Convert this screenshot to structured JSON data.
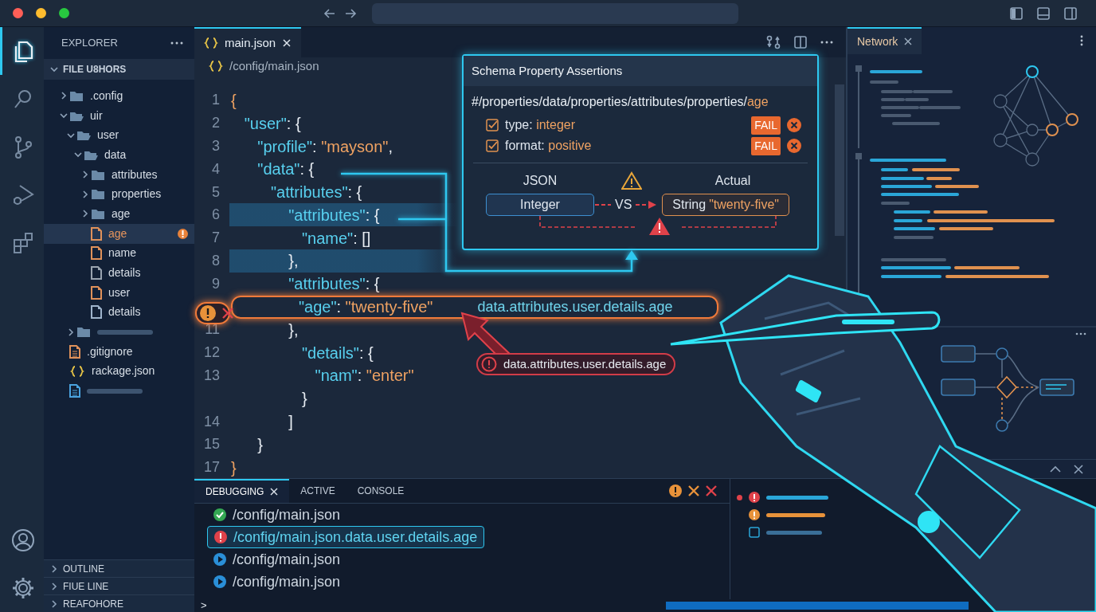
{
  "title_bar": {
    "traffic_lights": [
      {
        "color": "#ff5f57"
      },
      {
        "color": "#febc2e"
      },
      {
        "color": "#28c840"
      }
    ]
  },
  "activity_bar": {
    "items": [
      {
        "kind": "explorer",
        "selected": true
      },
      {
        "kind": "search",
        "selected": false
      },
      {
        "kind": "source-control",
        "selected": false
      },
      {
        "kind": "run-debug",
        "selected": false
      },
      {
        "kind": "extensions",
        "selected": false
      }
    ],
    "bottom_items": [
      {
        "kind": "account"
      },
      {
        "kind": "settings"
      }
    ]
  },
  "sidebar": {
    "title": "EXPLORER",
    "section": "FILE U8HORS",
    "section_expanded": true,
    "tree": [
      {
        "kind": "folder",
        "label": ".config",
        "expanded": false
      },
      {
        "kind": "folder",
        "label": "uir",
        "expanded": true,
        "children": [
          {
            "kind": "folder",
            "label": "user",
            "expanded": true,
            "children": [
              {
                "kind": "folder",
                "label": "data",
                "expanded": true,
                "children": [
                  {
                    "kind": "folder",
                    "label": "attributes",
                    "expanded": false
                  },
                  {
                    "kind": "folder",
                    "label": "properties",
                    "expanded": false
                  },
                  {
                    "kind": "folder",
                    "label": "age",
                    "expanded": false
                  },
                  {
                    "kind": "file",
                    "label": "age",
                    "color": "#e0915a",
                    "selected": true,
                    "warning": true
                  },
                  {
                    "kind": "file",
                    "label": "name",
                    "color": "#e0915a",
                    "selected": false,
                    "warning": false
                  },
                  {
                    "kind": "file",
                    "label": "details",
                    "color": "#9aa4b0",
                    "selected": false,
                    "warning": false
                  },
                  {
                    "kind": "file",
                    "label": "user",
                    "color": "#e0915a",
                    "selected": false,
                    "warning": false
                  },
                  {
                    "kind": "file",
                    "label": "details",
                    "color": "#9fb4cc",
                    "selected": false,
                    "warning": false
                  }
                ]
              }
            ]
          },
          {
            "kind": "folder",
            "expanded": false
          }
        ]
      },
      {
        "kind": "file",
        "label": ".gitignore",
        "color": "#e0915a",
        "selected": false,
        "warning": false
      },
      {
        "kind": "json",
        "label": "rackage.json",
        "color": "#e8c547",
        "selected": false,
        "warning": false
      },
      {
        "kind": "file",
        "color": "#4aa3df",
        "selected": false,
        "warning": false
      }
    ],
    "sections": [
      {
        "label": "OUTLINE",
        "expanded": false
      },
      {
        "label": "FIUE LINE",
        "expanded": false
      },
      {
        "label": "REAFOHORE",
        "expanded": false
      }
    ]
  },
  "editor": {
    "tabs": [
      {
        "label": "main.json",
        "selected": true
      }
    ],
    "breadcrumb": "/config/main.json",
    "lines": [
      {
        "number": "1",
        "highlighted": false,
        "error": false,
        "tokens": [
          {
            "kind": "brace",
            "text": "{"
          }
        ]
      },
      {
        "number": "2",
        "highlighted": false,
        "error": false,
        "tokens": [
          {
            "kind": "key",
            "text": "   \"user\""
          },
          {
            "kind": "punct",
            "text": ": {"
          }
        ]
      },
      {
        "number": "3",
        "highlighted": false,
        "error": false,
        "tokens": [
          {
            "kind": "key",
            "text": "      \"profile\""
          },
          {
            "kind": "punct",
            "text": ": "
          },
          {
            "kind": "string",
            "text": "\"mayson\""
          },
          {
            "kind": "punct",
            "text": ","
          }
        ]
      },
      {
        "number": "4",
        "highlighted": false,
        "error": false,
        "tokens": [
          {
            "kind": "key",
            "text": "      \"data\""
          },
          {
            "kind": "punct",
            "text": ": {"
          }
        ]
      },
      {
        "number": "5",
        "highlighted": false,
        "error": false,
        "tokens": [
          {
            "kind": "key",
            "text": "         \"attributes\""
          },
          {
            "kind": "punct",
            "text": ": {"
          }
        ]
      },
      {
        "number": "6",
        "highlighted": true,
        "error": false,
        "tokens": [
          {
            "kind": "key",
            "text": "             \"attributes\""
          },
          {
            "kind": "punct",
            "text": ": {"
          }
        ]
      },
      {
        "number": "7",
        "highlighted": false,
        "error": false,
        "tokens": [
          {
            "kind": "key",
            "text": "                \"name\""
          },
          {
            "kind": "punct",
            "text": ": []"
          }
        ]
      },
      {
        "number": "8",
        "highlighted": true,
        "error": false,
        "tokens": [
          {
            "kind": "punct",
            "text": "             },"
          }
        ]
      },
      {
        "number": "9",
        "highlighted": false,
        "error": false,
        "tokens": [
          {
            "kind": "key",
            "text": "             \"attributes\""
          },
          {
            "kind": "punct",
            "text": ": {"
          }
        ]
      },
      {
        "highlighted": false,
        "error": true,
        "hint": "data.attributes.user.details.age",
        "tokens": [
          {
            "kind": "key",
            "text": "                \"age\""
          },
          {
            "kind": "punct",
            "text": ": "
          },
          {
            "kind": "string",
            "text": "\"twenty-five\""
          }
        ]
      },
      {
        "number": "11",
        "highlighted": false,
        "error": false,
        "tokens": [
          {
            "kind": "punct",
            "text": "             },"
          }
        ]
      },
      {
        "number": "12",
        "highlighted": false,
        "error": false,
        "tokens": [
          {
            "kind": "key",
            "text": "                \"details\""
          },
          {
            "kind": "punct",
            "text": ": {"
          }
        ]
      },
      {
        "number": "13",
        "highlighted": false,
        "error": false,
        "tokens": [
          {
            "kind": "key",
            "text": "                   \"nam\""
          },
          {
            "kind": "punct",
            "text": ": "
          },
          {
            "kind": "string",
            "text": "\"enter\""
          }
        ]
      },
      {
        "highlighted": false,
        "error": false,
        "tokens": [
          {
            "kind": "punct",
            "text": "                }"
          }
        ]
      },
      {
        "number": "14",
        "highlighted": false,
        "error": false,
        "tokens": [
          {
            "kind": "punct",
            "text": "             ]"
          }
        ]
      },
      {
        "number": "15",
        "highlighted": false,
        "error": false,
        "tokens": [
          {
            "kind": "punct",
            "text": "      }"
          }
        ]
      },
      {
        "number": "17",
        "highlighted": false,
        "error": false,
        "tokens": [
          {
            "kind": "brace",
            "text": "}"
          }
        ]
      }
    ],
    "error_tooltip": "data.attributes.user.details.age"
  },
  "assertions_popup": {
    "title": "Schema Property Assertions",
    "path": [
      {
        "kind": "plain",
        "text": "#/properties/data/properties/attributes/properties/"
      },
      {
        "kind": "highlight",
        "text": "age"
      }
    ],
    "rules": [
      {
        "checked": true,
        "label": "type:",
        "value": "integer",
        "status": "FAIL"
      },
      {
        "checked": true,
        "label": "format:",
        "value": "positive",
        "status": "FAIL"
      }
    ],
    "comparison": {
      "left_label": "JSON",
      "left_value": "Integer",
      "middle": "VS",
      "right_label": "Actual",
      "right_type": "String",
      "right_value": "\"twenty-five\""
    }
  },
  "right_panel": {
    "tabs": [
      {
        "label": "Network",
        "selected": true
      }
    ]
  },
  "bottom_panel": {
    "tabs": [
      {
        "label": "DEBUGGING",
        "selected": true,
        "closable": true
      },
      {
        "label": "ACTIVE",
        "selected": false,
        "closable": false
      },
      {
        "label": "CONSOLE",
        "selected": false,
        "closable": false
      }
    ],
    "rows": [
      {
        "kind": "success",
        "text": "/config/main.json",
        "selected": false
      },
      {
        "kind": "error",
        "text": "/config/main.json.data.user.details.age",
        "selected": true
      },
      {
        "kind": "running",
        "text": "/config/main.json",
        "selected": false
      },
      {
        "kind": "running",
        "text": "/config/main.json",
        "selected": false
      }
    ],
    "problems": [
      {
        "kind": "error",
        "unread": true
      },
      {
        "kind": "warning",
        "unread": false
      },
      {
        "kind": "task",
        "unread": false
      }
    ],
    "prompt": ">"
  }
}
